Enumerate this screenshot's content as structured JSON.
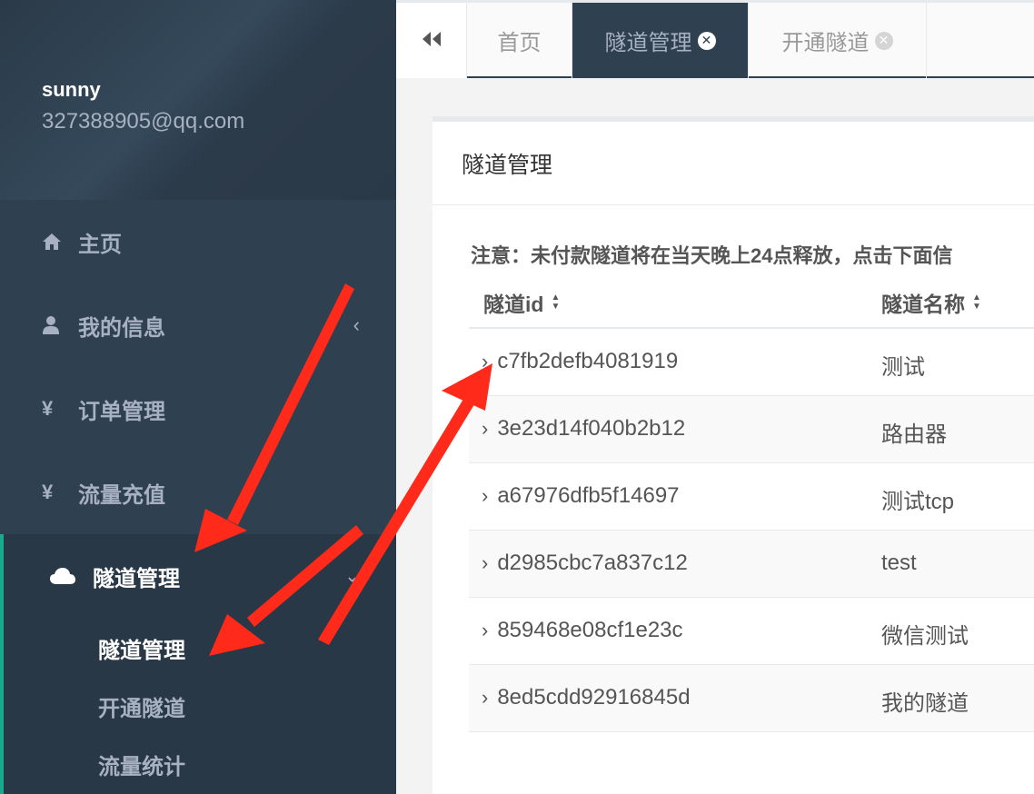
{
  "profile": {
    "name": "sunny",
    "email": "327388905@qq.com"
  },
  "sidebar": {
    "items": [
      {
        "label": "主页",
        "icon": "home-icon"
      },
      {
        "label": "我的信息",
        "icon": "user-icon"
      },
      {
        "label": "订单管理",
        "icon": "yen-icon"
      },
      {
        "label": "流量充值",
        "icon": "yen-icon"
      }
    ],
    "active": {
      "label": "隧道管理",
      "icon": "cloud-icon",
      "children": [
        "隧道管理",
        "开通隧道",
        "流量统计"
      ]
    },
    "yen_symbol": "¥"
  },
  "tabs": [
    {
      "label": "首页",
      "active": false,
      "closable": false
    },
    {
      "label": "隧道管理",
      "active": true,
      "closable": true
    },
    {
      "label": "开通隧道",
      "active": false,
      "closable": true
    }
  ],
  "panel": {
    "title": "隧道管理",
    "notice": "注意：未付款隧道将在当天晚上24点释放，点击下面信",
    "columns": [
      "隧道id",
      "隧道名称"
    ],
    "rows": [
      {
        "id": "c7fb2defb4081919",
        "name": "测试"
      },
      {
        "id": "3e23d14f040b2b12",
        "name": "路由器"
      },
      {
        "id": "a67976dfb5f14697",
        "name": "测试tcp"
      },
      {
        "id": "d2985cbc7a837c12",
        "name": "test"
      },
      {
        "id": "859468e08cf1e23c",
        "name": "微信测试"
      },
      {
        "id": "8ed5cdd92916845d",
        "name": "我的隧道"
      }
    ]
  },
  "colors": {
    "sidebar": "#2f4050",
    "accent": "#19aa8d",
    "arrow": "#ff2a1a"
  }
}
